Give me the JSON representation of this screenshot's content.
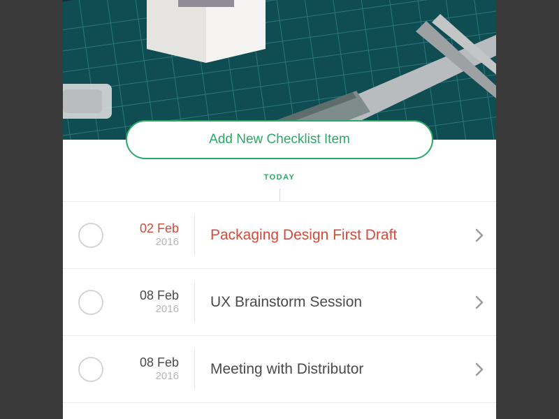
{
  "add_button_label": "Add New Checklist Item",
  "today_label": "TODAY",
  "colors": {
    "accent": "#2aa866",
    "overdue": "#d24a3a"
  },
  "items": [
    {
      "date": "02 Feb",
      "year": "2016",
      "title": "Packaging Design First Draft",
      "overdue": true
    },
    {
      "date": "08 Feb",
      "year": "2016",
      "title": "UX Brainstorm Session",
      "overdue": false
    },
    {
      "date": "08 Feb",
      "year": "2016",
      "title": "Meeting with Distributor",
      "overdue": false
    }
  ]
}
